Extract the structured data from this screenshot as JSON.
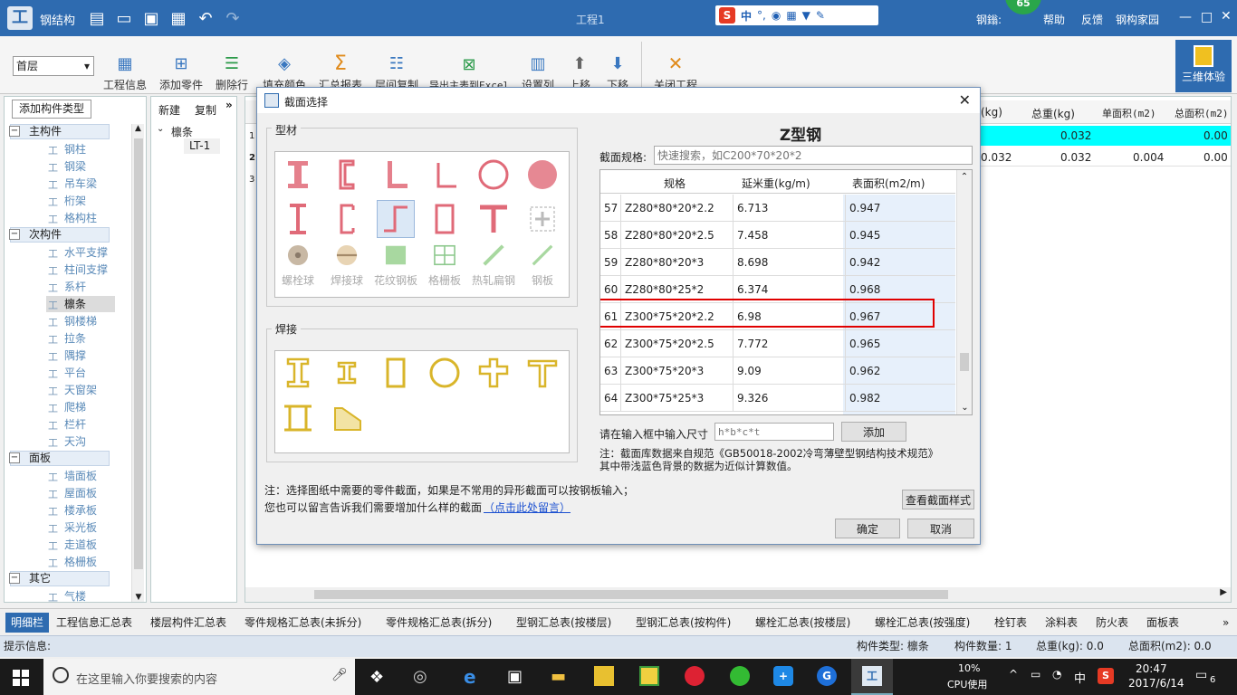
{
  "app": {
    "title": "钢结构",
    "window_title": "工程1",
    "badge_count": "65",
    "menu_right": [
      "钢鎓:",
      "帮助",
      "反馈",
      "钢构家园"
    ]
  },
  "ime": {
    "items": [
      "中",
      "°,"
    ]
  },
  "toolbar": {
    "floor_select": "首层",
    "buttons": [
      "工程信息",
      "添加零件",
      "删除行",
      "填充颜色",
      "汇总报表",
      "层间复制",
      "导出主表到Excel",
      "设置列",
      "上移",
      "下移",
      "关闭工程"
    ],
    "three_d": "三维体验"
  },
  "left_panel": {
    "header_button": "添加构件类型",
    "groups": [
      {
        "label": "主构件",
        "items": [
          "钢柱",
          "钢梁",
          "吊车梁",
          "桁架",
          "格构柱"
        ]
      },
      {
        "label": "次构件",
        "items": [
          "水平支撑",
          "柱间支撑",
          "系杆",
          "檩条",
          "钢楼梯",
          "拉条",
          "隅撑",
          "平台",
          "天窗架",
          "爬梯",
          "栏杆",
          "天沟"
        ]
      },
      {
        "label": "面板",
        "items": [
          "墙面板",
          "屋面板",
          "楼承板",
          "采光板",
          "走道板",
          "格栅板"
        ]
      },
      {
        "label": "其它",
        "items": [
          "气楼"
        ]
      }
    ]
  },
  "mid_panel": {
    "new": "新建",
    "copy": "复制",
    "expand": "»",
    "node": "檩条",
    "child": "LT-1"
  },
  "grid": {
    "headers": [
      "(kg)",
      "总重(kg)",
      "单面积(m2)",
      "总面积(m2)"
    ],
    "row_nums": [
      "1",
      "2",
      "3"
    ],
    "rows": [
      [
        "",
        "0.032",
        "",
        "0.00"
      ],
      [
        "0.032",
        "0.032",
        "0.004",
        "0.00"
      ]
    ]
  },
  "dialog": {
    "title": "截面选择",
    "close": "✕",
    "section_profiles": "型材",
    "profile_labels": [
      "螺栓球",
      "焊接球",
      "花纹钢板",
      "格栅板",
      "热轧扁钢",
      "钢板"
    ],
    "section_weld": "焊接",
    "right_title": "Z型钢",
    "search_label": "截面规格:",
    "search_placeholder": "快速搜索，如C200*70*20*2",
    "table_headers": [
      "规格",
      "延米重(kg/m)",
      "表面积(m2/m)"
    ],
    "rows": [
      {
        "n": "57",
        "spec": "Z280*80*20*2.2",
        "w": "6.713",
        "a": "0.947"
      },
      {
        "n": "58",
        "spec": "Z280*80*20*2.5",
        "w": "7.458",
        "a": "0.945"
      },
      {
        "n": "59",
        "spec": "Z280*80*20*3",
        "w": "8.698",
        "a": "0.942"
      },
      {
        "n": "60",
        "spec": "Z280*80*25*2",
        "w": "6.374",
        "a": "0.968"
      },
      {
        "n": "61",
        "spec": "Z300*75*20*2.2",
        "w": "6.98",
        "a": "0.967"
      },
      {
        "n": "62",
        "spec": "Z300*75*20*2.5",
        "w": "7.772",
        "a": "0.965"
      },
      {
        "n": "63",
        "spec": "Z300*75*20*3",
        "w": "9.09",
        "a": "0.962"
      },
      {
        "n": "64",
        "spec": "Z300*75*25*3",
        "w": "9.326",
        "a": "0.982"
      }
    ],
    "size_label": "请在输入框中输入尺寸",
    "size_placeholder": "h*b*c*t",
    "add": "添加",
    "note1": "注：截面库数据来自规范《GB50018-2002冷弯薄壁型钢结构技术规范》",
    "note2": "其中带浅蓝色背景的数据为近似计算数值。",
    "bottom_note1": "注：选择图纸中需要的零件截面，如果是不常用的异形截面可以按钢板输入；",
    "bottom_note2": "您也可以留言告诉我们需要增加什么样的截面",
    "link": "（点击此处留言）",
    "view_style": "查看截面样式",
    "ok": "确定",
    "cancel": "取消"
  },
  "tabs": [
    "明细栏",
    "工程信息汇总表",
    "楼层构件汇总表",
    "零件规格汇总表(未拆分)",
    "零件规格汇总表(拆分)",
    "型钢汇总表(按楼层)",
    "型钢汇总表(按构件)",
    "螺栓汇总表(按楼层)",
    "螺栓汇总表(按强度)",
    "栓钉表",
    "涂料表",
    "防火表",
    "面板表"
  ],
  "status": {
    "hint": "提示信息:",
    "type": "构件类型: 檩条",
    "count": "构件数量: 1",
    "weight": "总重(kg): 0.0",
    "area": "总面积(m2): 0.0"
  },
  "taskbar": {
    "search": "在这里输入你要搜索的内容",
    "cpu_pct": "10%",
    "cpu_label": "CPU使用",
    "time": "20:47",
    "date": "2017/6/14",
    "lang": "中",
    "notif": "6"
  },
  "colors": {
    "title_blue": "#2e6bb0",
    "highlight": "#00ffff",
    "red_box": "#e00000",
    "profile_red": "#e06a78",
    "weld_gold": "#d9b52a"
  }
}
